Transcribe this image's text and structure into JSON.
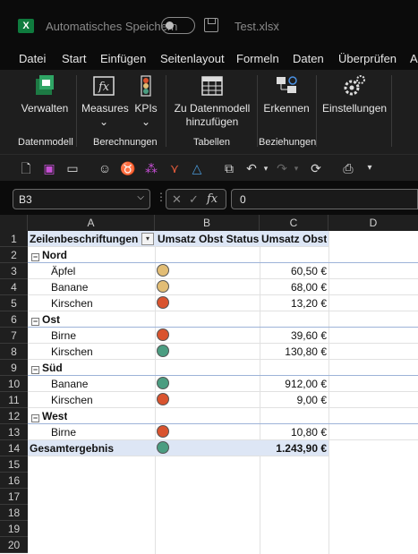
{
  "title": {
    "autosave_label": "Automatisches Speichern",
    "filename": "Test.xlsx",
    "filename_chevron": "⌵"
  },
  "menu": [
    "Datei",
    "Start",
    "Einfügen",
    "Seitenlayout",
    "Formeln",
    "Daten",
    "Überprüfen",
    "A"
  ],
  "ribbon": {
    "buttons": {
      "verwalten": "Verwalten",
      "measures": "Measures",
      "measures_arrow": "⌄",
      "kpis": "KPIs",
      "kpis_arrow": "⌄",
      "datenmodell_l1": "Zu Datenmodell",
      "datenmodell_l2": "hinzufügen",
      "erkennen": "Erkennen",
      "einstellungen": "Einstellungen"
    },
    "groups": {
      "datenmodell": "Datenmodell",
      "berechnungen": "Berechnungen",
      "tabellen": "Tabellen",
      "beziehungen": "Beziehungen"
    }
  },
  "formula_bar": {
    "name_box": "B3",
    "fx": "fx",
    "value": "0"
  },
  "columns": [
    "A",
    "B",
    "C",
    "D"
  ],
  "rows": [
    "1",
    "2",
    "3",
    "4",
    "5",
    "6",
    "7",
    "8",
    "9",
    "10",
    "11",
    "12",
    "13",
    "14",
    "15",
    "16",
    "17",
    "18",
    "19",
    "20"
  ],
  "pivot": {
    "header": {
      "a": "Zeilenbeschriftungen",
      "b": "Umsatz Obst Status",
      "c": "Umsatz Obst"
    },
    "lines": [
      {
        "kind": "region",
        "label": "Nord",
        "value": "",
        "status": ""
      },
      {
        "kind": "item",
        "label": "Äpfel",
        "value": "60,50 €",
        "status": "yellow"
      },
      {
        "kind": "item",
        "label": "Banane",
        "value": "68,00 €",
        "status": "yellow"
      },
      {
        "kind": "item",
        "label": "Kirschen",
        "value": "13,20 €",
        "status": "red"
      },
      {
        "kind": "region",
        "label": "Ost",
        "value": "",
        "status": ""
      },
      {
        "kind": "item",
        "label": "Birne",
        "value": "39,60 €",
        "status": "red"
      },
      {
        "kind": "item",
        "label": "Kirschen",
        "value": "130,80 €",
        "status": "green"
      },
      {
        "kind": "region",
        "label": "Süd",
        "value": "",
        "status": ""
      },
      {
        "kind": "item",
        "label": "Banane",
        "value": "912,00 €",
        "status": "green"
      },
      {
        "kind": "item",
        "label": "Kirschen",
        "value": "9,00 €",
        "status": "red"
      },
      {
        "kind": "region",
        "label": "West",
        "value": "",
        "status": ""
      },
      {
        "kind": "item",
        "label": "Birne",
        "value": "10,80 €",
        "status": "red"
      },
      {
        "kind": "total",
        "label": "Gesamtergebnis",
        "value": "1.243,90 €",
        "status": "green"
      }
    ]
  },
  "colors": {
    "yellow": "#e2bd75",
    "red": "#d9532e",
    "green": "#4b9d81",
    "excel_green": "#1d7a44"
  }
}
